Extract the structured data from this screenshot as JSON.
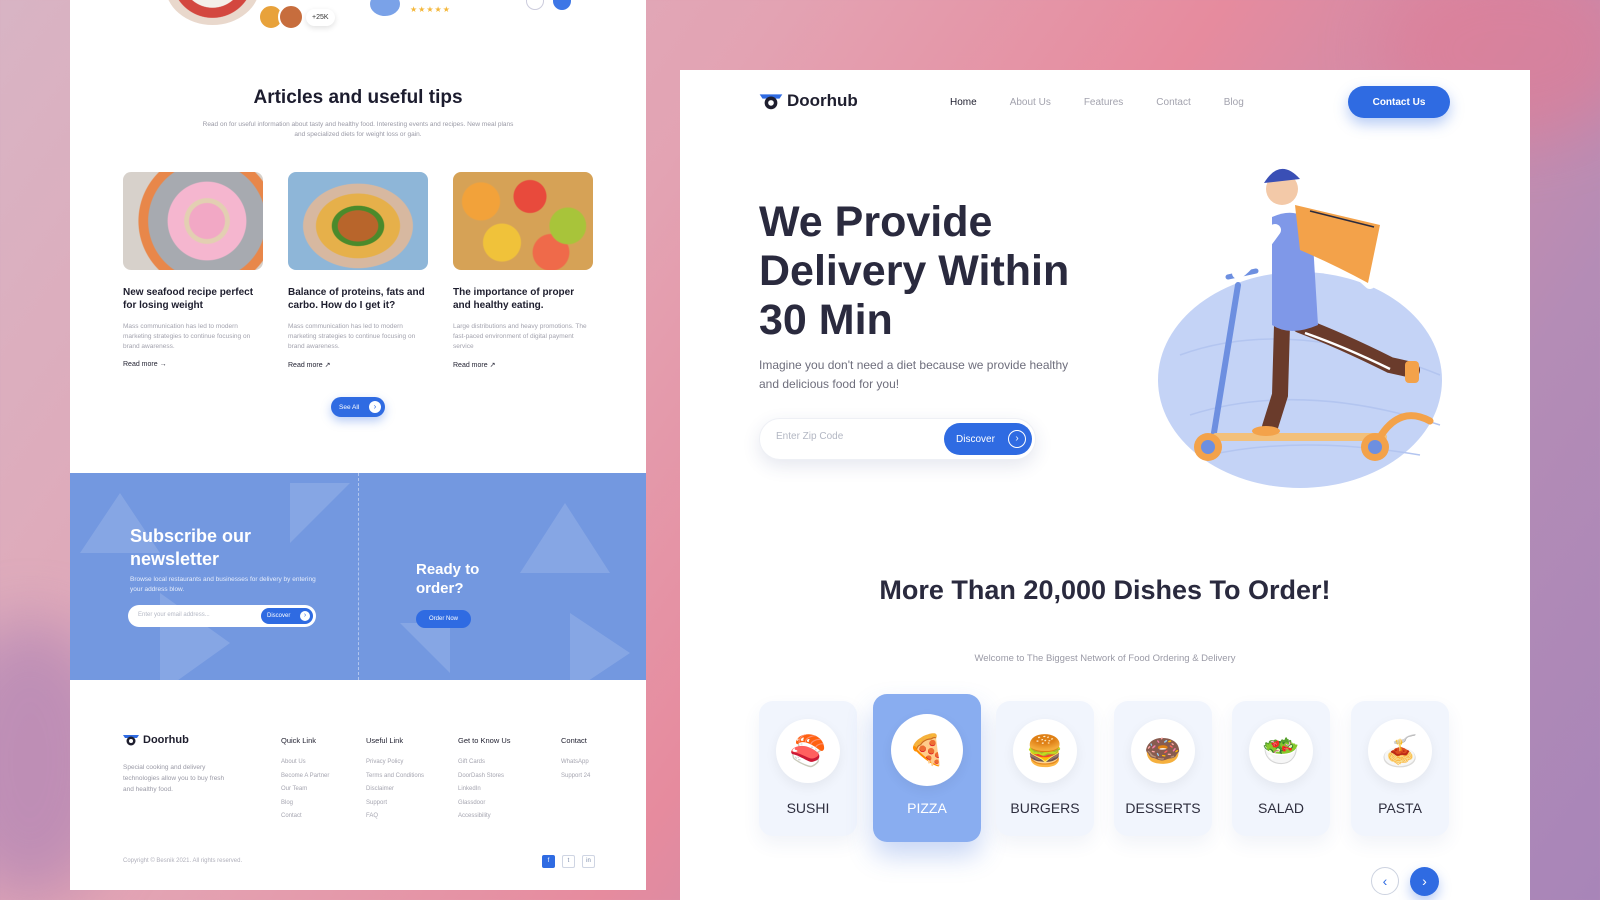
{
  "colors": {
    "accent": "#2f6be2",
    "newsletter_bg": "#7398e0",
    "dark_text": "#2a2a3e"
  },
  "left": {
    "top_strip": {
      "avatar_count": "+25K",
      "stars": "★★★★★"
    },
    "articles": {
      "title": "Articles and useful tips",
      "subtitle": "Read on for useful information about tasty and healthy food. Interesting events and recipes. New meal plans and specialized diets for weight loss or gain.",
      "items": [
        {
          "title": "New seafood recipe perfect for losing weight",
          "text": "Mass communication has led to modern marketing strategies to continue focusing on brand awareness.",
          "more": "Read more →",
          "image": "donut-photo"
        },
        {
          "title": "Balance of proteins, fats and carbo. How do I get it?",
          "text": "Mass communication has led to modern marketing strategies to continue focusing on brand awareness.",
          "more": "Read more ↗",
          "image": "burger-photo"
        },
        {
          "title": "The importance of proper and healthy eating.",
          "text": "Large distributions and heavy promotions. The fast-paced environment of digital payment service",
          "more": "Read more ↗",
          "image": "citrus-photo"
        }
      ],
      "see_all": "See All"
    },
    "newsletter": {
      "title": "Subscribe our newsletter",
      "text": "Browse local restaurants and businesses for delivery by entering your address blow.",
      "placeholder": "Enter your email address...",
      "button": "Discover",
      "ready_title": "Ready to order?",
      "order_button": "Order Now"
    },
    "footer": {
      "brand": "Doorhub",
      "description": "Special cooking and delivery technologies allow you to buy fresh and healthy food.",
      "columns": [
        {
          "heading": "Quick Link",
          "links": [
            "About Us",
            "Become A Partner",
            "Our Team",
            "Blog",
            "Contact"
          ]
        },
        {
          "heading": "Useful Link",
          "links": [
            "Privacy Policy",
            "Terms and Conditions",
            "Disclaimer",
            "Support",
            "FAQ"
          ]
        },
        {
          "heading": "Get to Know Us",
          "links": [
            "Gift Cards",
            "DoorDash Stores",
            "LinkedIn",
            "Glassdoor",
            "Accessibility"
          ]
        },
        {
          "heading": "Contact",
          "links": [
            "WhatsApp",
            "Support 24"
          ]
        }
      ],
      "copyright": "Copyright © Besnik 2021. All rights reserved.",
      "socials": [
        "f",
        "t",
        "in"
      ]
    }
  },
  "right": {
    "brand": "Doorhub",
    "nav": [
      "Home",
      "About Us",
      "Features",
      "Contact",
      "Blog"
    ],
    "nav_active": "Home",
    "contact_button": "Contact Us",
    "hero": {
      "title": "We Provide Delivery Within 30 Min",
      "subtitle": "Imagine you don't need a diet because we provide healthy and delicious food for you!",
      "zip_placeholder": "Enter Zip Code",
      "discover": "Discover"
    },
    "section_title": "More Than 20,000 Dishes To Order!",
    "section_subtitle": "Welcome to The Biggest Network of Food Ordering & Delivery",
    "categories": [
      {
        "name": "SUSHI",
        "icon": "sushi-icon",
        "glyph": "🍣"
      },
      {
        "name": "PIZZA",
        "icon": "pizza-icon",
        "glyph": "🍕",
        "active": true
      },
      {
        "name": "BURGERS",
        "icon": "burger-icon",
        "glyph": "🍔"
      },
      {
        "name": "DESSERTS",
        "icon": "donut-icon",
        "glyph": "🍩"
      },
      {
        "name": "SALAD",
        "icon": "salad-icon",
        "glyph": "🥗"
      },
      {
        "name": "PASTA",
        "icon": "pasta-icon",
        "glyph": "🍝"
      }
    ],
    "pager": {
      "prev": "‹",
      "next": "›"
    }
  }
}
